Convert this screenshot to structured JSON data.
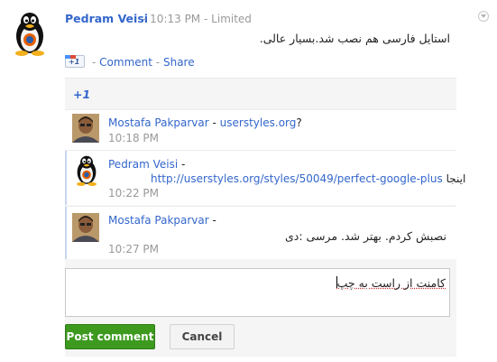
{
  "post": {
    "author": "Pedram Veisi",
    "time": "10:13 PM",
    "visibility": "Limited",
    "text": "استایل فارسی هم نصب شد.بسیار عالی.",
    "plusone_badge": "+1",
    "comment_link": "Comment",
    "share_link": "Share",
    "separator": "-",
    "avatar_icon": "tux-penguin-icon",
    "menu_icon": "chevron-down-icon"
  },
  "plusones": "+1",
  "comments": [
    {
      "author": "Mostafa Pakparvar",
      "separator": " - ",
      "link": "userstyles.org",
      "suffix": "?",
      "time": "10:18 PM",
      "avatar_icon": "person-photo-icon"
    },
    {
      "author": "Pedram Veisi",
      "separator": " -",
      "link": "http://userstyles.org/styles/50049/perfect-google-plus",
      "suffix": "اینجا",
      "time": "10:22 PM",
      "avatar_icon": "tux-penguin-icon"
    },
    {
      "author": "Mostafa Pakparvar",
      "separator": " -",
      "text": "نصبش کردم. بهتر شد. مرسی :دی",
      "time": "10:27 PM",
      "avatar_icon": "person-photo-icon"
    }
  ],
  "new_comment": {
    "value": "کامنت از راست به چپ"
  },
  "buttons": {
    "post": "Post comment",
    "cancel": "Cancel"
  },
  "colors": {
    "link": "#3366cc",
    "post_button": "#3d9a1f",
    "muted": "#999999"
  }
}
